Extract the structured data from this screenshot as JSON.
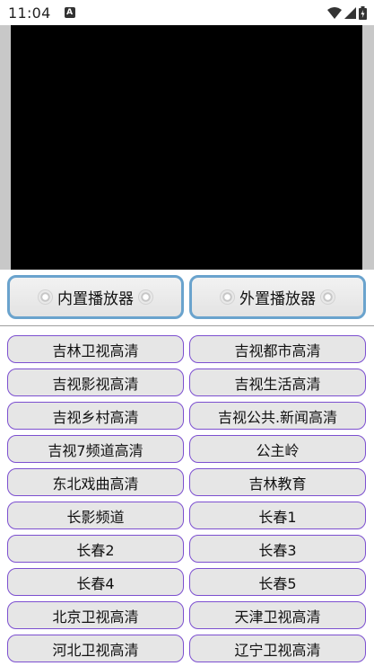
{
  "status_bar": {
    "time": "11:04",
    "notification_icon": "A",
    "icons": [
      "wifi-icon",
      "signal-icon",
      "battery-icon"
    ]
  },
  "players": {
    "internal_label": "内置播放器",
    "external_label": "外置播放器"
  },
  "channels": [
    "吉林卫视高清",
    "吉视都市高清",
    "吉视影视高清",
    "吉视生活高清",
    "吉视乡村高清",
    "吉视公共.新闻高清",
    "吉视7频道高清",
    "公主岭",
    "东北戏曲高清",
    "吉林教育",
    "长影频道",
    "长春1",
    "长春2",
    "长春3",
    "长春4",
    "长春5",
    "北京卫视高清",
    "天津卫视高清",
    "河北卫视高清",
    "辽宁卫视高清"
  ],
  "colors": {
    "player_border": "#6aa3cd",
    "channel_border": "#7c4fd0",
    "video_bg": "#000000"
  }
}
